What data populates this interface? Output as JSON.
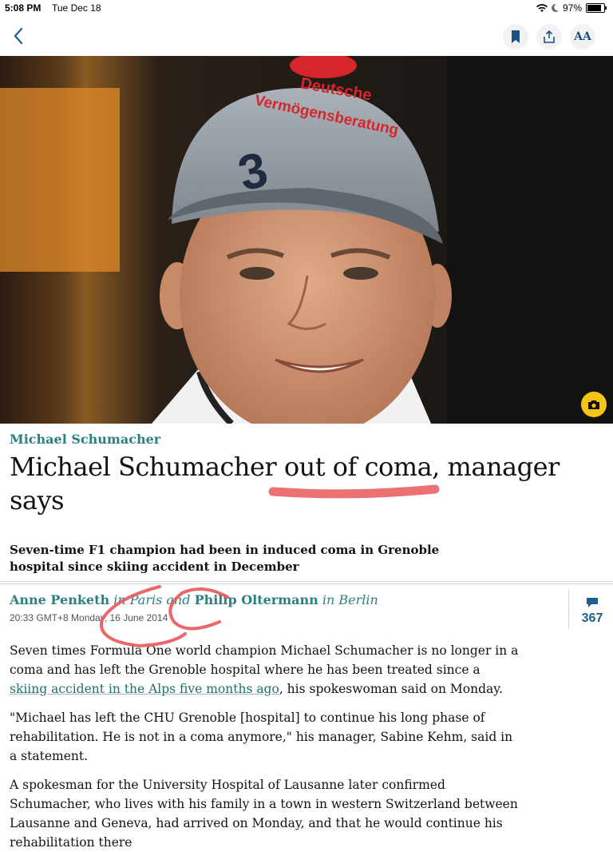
{
  "status_bar": {
    "time": "5:08 PM",
    "date": "Tue Dec 18",
    "battery": "97%",
    "battery_level": 0.97
  },
  "toolbar": {
    "font_label": "AA"
  },
  "hero": {
    "cap_text_1": "Deutsche",
    "cap_text_2": "Vermögensberatung",
    "cap_number": "3"
  },
  "article": {
    "kicker": "Michael Schumacher",
    "headline": "Michael Schumacher out of coma, manager says",
    "standfirst": "Seven-time F1 champion had been in induced coma in Grenoble hospital since skiing accident in December",
    "byline": {
      "author1": "Anne Penketh",
      "in1": " in ",
      "place1": "Paris",
      "and": " and ",
      "author2": "Philip Oltermann",
      "in2": " in ",
      "place2": "Berlin"
    },
    "dateline": "20:33 GMT+8 Monday, 16 June 2014",
    "comment_count": "367",
    "paragraphs": {
      "p1_a": "Seven times Formula One world champion Michael Schumacher is no longer in a coma and has left the Grenoble hospital where he has been treated since a ",
      "p1_link": "skiing accident in the Alps five months ago",
      "p1_b": ", his spokeswoman said on Monday.",
      "p2": "\"Michael has left the CHU Grenoble [hospital] to continue his long phase of rehabilitation. He is not in a coma anymore,\" his manager, Sabine Kehm, said in a statement.",
      "p3": "A spokesman for the University Hospital of Lausanne later confirmed Schumacher, who lives with his family in a town in western Switzerland between Lausanne and Geneva, had arrived on Monday, and that he would continue his rehabilitation there"
    }
  },
  "colors": {
    "section": "#2a7f7f",
    "annotation": "#e8585a",
    "camera_badge": "#f5c518"
  }
}
